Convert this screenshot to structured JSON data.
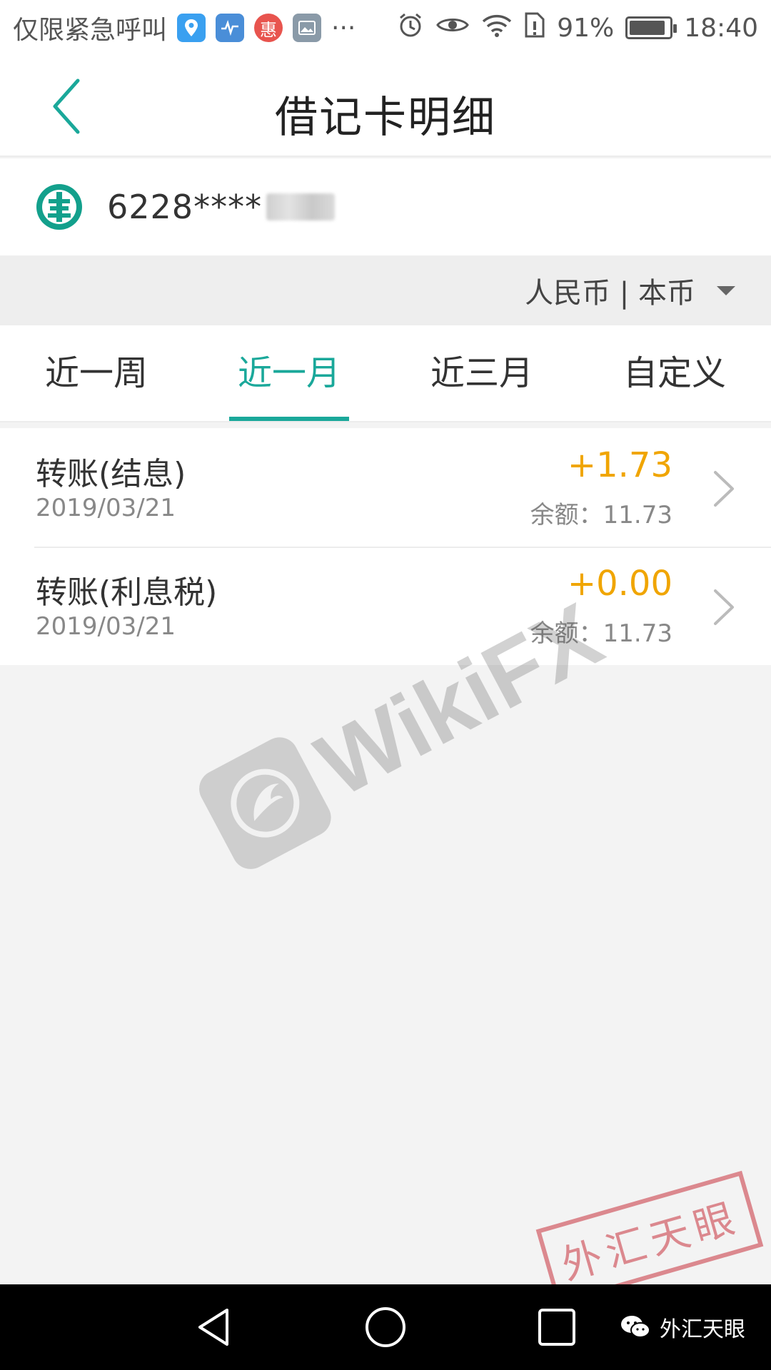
{
  "status_bar": {
    "carrier": "仅限紧急呼叫",
    "app_icons": [
      {
        "name": "location-app-icon",
        "color": "#3aa0f0"
      },
      {
        "name": "health-app-icon",
        "color": "#4a8ed8"
      },
      {
        "name": "hui-app-icon",
        "color": "#e8544e",
        "text": "惠"
      },
      {
        "name": "gallery-app-icon",
        "color": "#8a9aa8"
      }
    ],
    "more": "···",
    "battery_percent": "91%",
    "battery_level": 0.91,
    "time": "18:40"
  },
  "header": {
    "title": "借记卡明细"
  },
  "account": {
    "card_number_visible": "6228****"
  },
  "currency": {
    "label": "人民币 | 本币"
  },
  "tabs": [
    {
      "label": "近一周",
      "active": false
    },
    {
      "label": "近一月",
      "active": true
    },
    {
      "label": "近三月",
      "active": false
    },
    {
      "label": "自定义",
      "active": false
    }
  ],
  "transactions": [
    {
      "name": "转账(结息)",
      "date": "2019/03/21",
      "amount": "+1.73",
      "balance": "余额：11.73"
    },
    {
      "name": "转账(利息税)",
      "date": "2019/03/21",
      "amount": "+0.00",
      "balance": "余额：11.73"
    }
  ],
  "watermark": {
    "text": "WikiFX"
  },
  "stamp": {
    "text": "外汇天眼"
  },
  "footer": {
    "credit": "外汇天眼"
  },
  "colors": {
    "accent": "#1aa89a",
    "amount": "#f0a500",
    "stamp": "#c8323c"
  }
}
